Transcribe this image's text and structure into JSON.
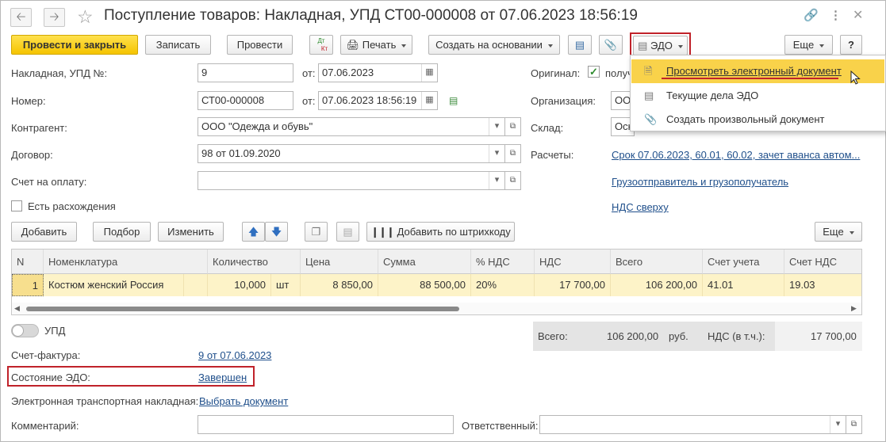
{
  "window": {
    "title": "Поступление товаров: Накладная, УПД СТ00-000008 от 07.06.2023 18:56:19",
    "icons": {
      "back": "arrow-left-icon",
      "forward": "arrow-right-icon",
      "star": "star-icon",
      "link": "link-icon",
      "more": "more-vertical-icon",
      "close": "close-icon"
    }
  },
  "toolbar": {
    "post_close": "Провести и закрыть",
    "save": "Записать",
    "post": "Провести",
    "dtkt_dt": "Дт",
    "dtkt_kt": "Кт",
    "print": "Печать",
    "create_based": "Создать на основании",
    "edo": "ЭДО",
    "more": "Еще",
    "help": "?"
  },
  "edo_menu": {
    "items": [
      "Просмотреть электронный документ",
      "Текущие дела ЭДО",
      "Создать произвольный документ"
    ]
  },
  "form": {
    "invoice_label": "Накладная, УПД №:",
    "invoice_value": "9",
    "from_label": "от:",
    "invoice_date": "07.06.2023",
    "number_label": "Номер:",
    "number_value": "СТ00-000008",
    "number_date": "07.06.2023 18:56:19",
    "counterparty_label": "Контрагент:",
    "counterparty_value": "ООО \"Одежда и обувь\"",
    "contract_label": "Договор:",
    "contract_value": "98 от 01.09.2020",
    "payment_label": "Счет на оплату:",
    "payment_value": "",
    "discrepancy_label": "Есть расхождения",
    "original_label": "Оригинал:",
    "original_value": "получ",
    "org_label": "Организация:",
    "org_value": "ОО",
    "warehouse_label": "Склад:",
    "warehouse_value": "Осн",
    "settlements_label": "Расчеты:",
    "settlements_link": "Срок 07.06.2023, 60.01, 60.02, зачет аванса автом...",
    "shipper_link": "Грузоотправитель и грузополучатель",
    "vat_link": "НДС сверху"
  },
  "table_toolbar": {
    "add": "Добавить",
    "pick": "Подбор",
    "edit": "Изменить",
    "barcode": "Добавить по штрихкоду",
    "more": "Еще"
  },
  "table": {
    "headers": [
      "N",
      "Номенклатура",
      "Количество",
      "Цена",
      "Сумма",
      "% НДС",
      "НДС",
      "Всего",
      "Счет учета",
      "Счет НДС"
    ],
    "rows": [
      {
        "n": "1",
        "name": "Костюм женский Россия",
        "qty": "10,000",
        "unit": "шт",
        "price": "8 850,00",
        "sum": "88 500,00",
        "vat_rate": "20%",
        "vat": "17 700,00",
        "total": "106 200,00",
        "account": "41.01",
        "vat_account": "19.03"
      }
    ]
  },
  "footer": {
    "upd_label": "УПД",
    "total_label": "Всего:",
    "total_value": "106 200,00",
    "currency": "руб.",
    "vat_label": "НДС (в т.ч.):",
    "vat_value": "17 700,00",
    "invoice_label": "Счет-фактура:",
    "invoice_link": "9 от 07.06.2023",
    "edo_state_label": "Состояние ЭДО:",
    "edo_state_link": "Завершен",
    "etn_label": "Электронная транспортная накладная:",
    "etn_link": "Выбрать документ",
    "comment_label": "Комментарий:",
    "comment_value": "",
    "responsible_label": "Ответственный:",
    "responsible_value": ""
  },
  "colors": {
    "accent": "#f5c400",
    "highlight": "#c0222a",
    "link": "#1f4f8b",
    "row": "#fdf3c8"
  }
}
